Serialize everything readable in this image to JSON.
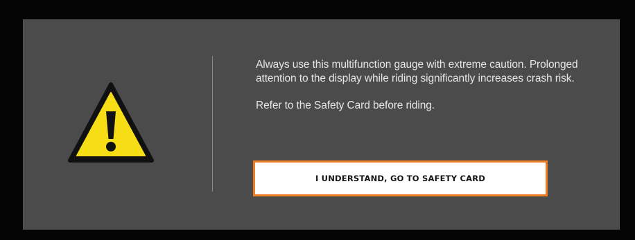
{
  "dialog": {
    "icon": "warning-triangle-icon",
    "colors": {
      "background": "#050505",
      "panel": "#4b4b4b",
      "warning_fill": "#f7dd16",
      "button_border": "#f07a22",
      "button_fill": "#ffffff"
    },
    "message_line_1": "Always use this multifunction gauge with extreme caution. Prolonged attention to the display while riding significantly increases crash risk.",
    "message_line_2": "Refer to the Safety Card before riding.",
    "button_label": "I UNDERSTAND, GO TO SAFETY CARD"
  }
}
